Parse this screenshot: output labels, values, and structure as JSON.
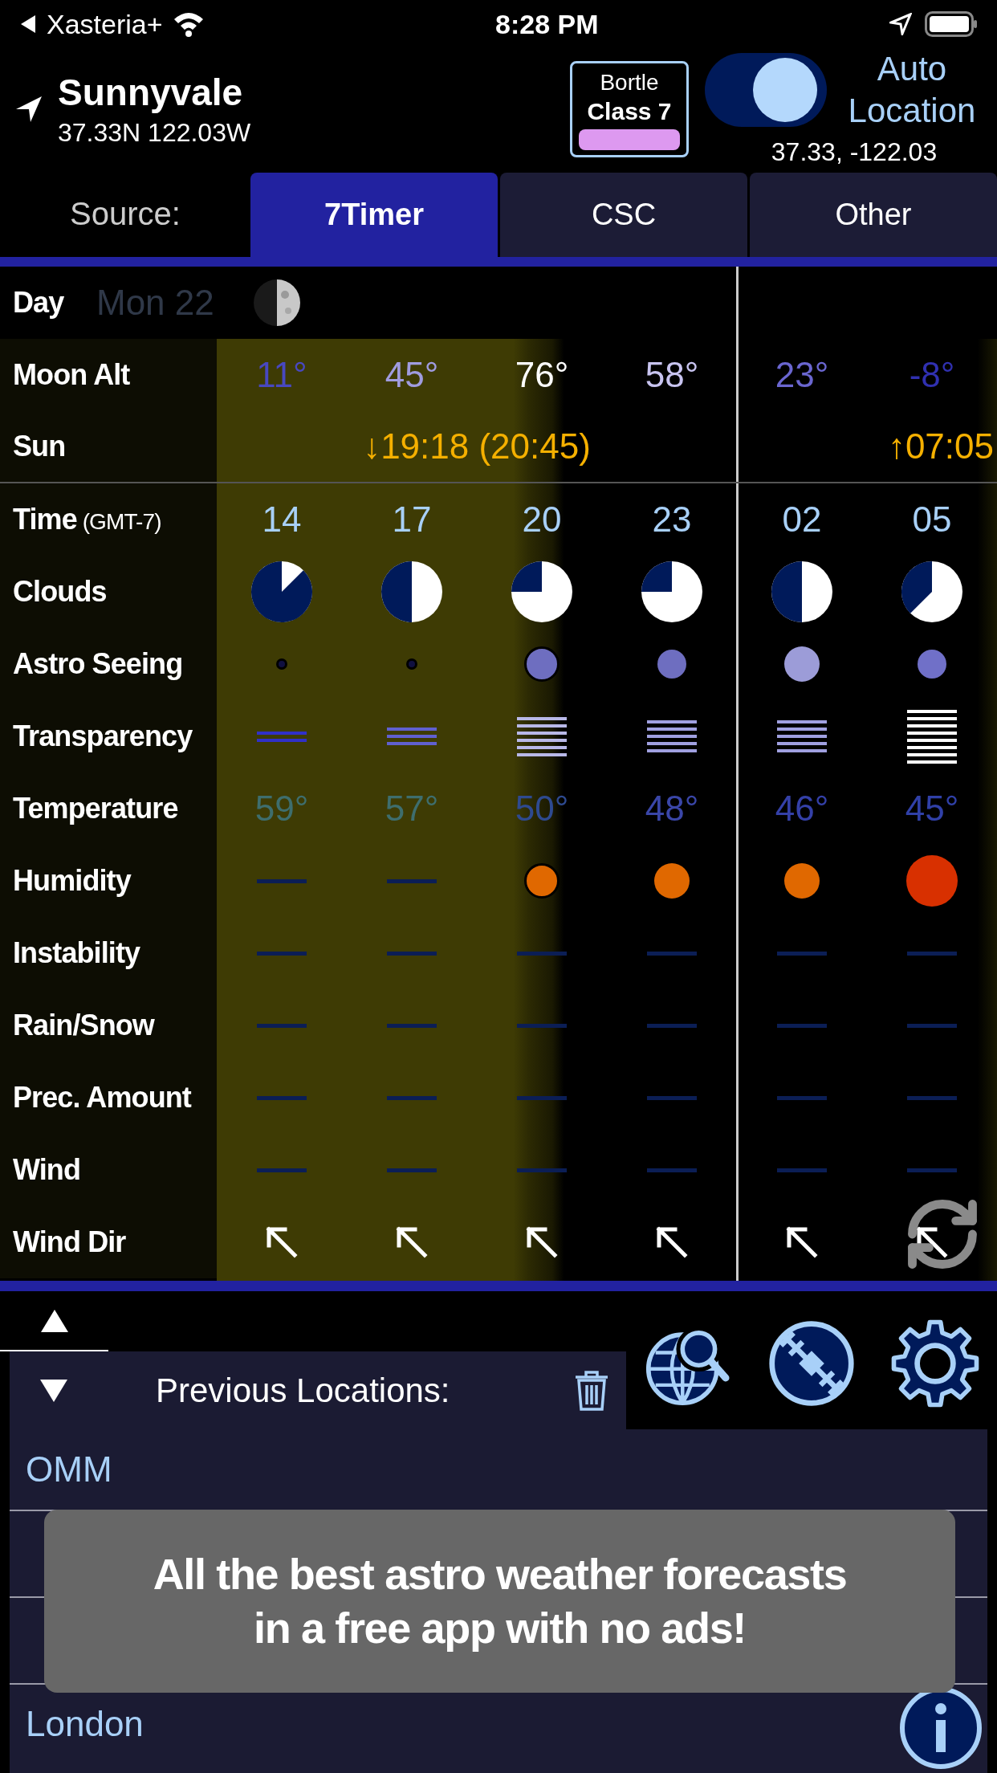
{
  "status_bar": {
    "back_label": "Xasteria+",
    "time": "8:28 PM"
  },
  "location": {
    "name": "Sunnyvale",
    "coords": "37.33N 122.03W"
  },
  "bortle": {
    "line1": "Bortle",
    "line2": "Class 7",
    "color": "#dd99f0"
  },
  "auto_location": {
    "on": true,
    "label": "Auto Location",
    "coords": "37.33, -122.03"
  },
  "source": {
    "label": "Source:",
    "tabs": [
      {
        "label": "7Timer",
        "selected": true
      },
      {
        "label": "CSC",
        "selected": false
      },
      {
        "label": "Other",
        "selected": false
      }
    ]
  },
  "forecast": {
    "day": {
      "label": "Day",
      "date": "Mon 22"
    },
    "rows": [
      {
        "kind": "cells",
        "label": "Moon Alt",
        "cells": [
          {
            "kind": "text",
            "text": "11°",
            "color": "#4848c0"
          },
          {
            "kind": "text",
            "text": "45°",
            "color": "#a09ce0"
          },
          {
            "kind": "text",
            "text": "76°",
            "color": "#ffffff"
          },
          {
            "kind": "text",
            "text": "58°",
            "color": "#c8c4f0"
          },
          {
            "kind": "text",
            "text": "23°",
            "color": "#6a66d0"
          },
          {
            "kind": "text",
            "text": "-8°",
            "color": "#3030b0"
          }
        ]
      },
      {
        "kind": "span",
        "label": "Sun",
        "sunset": "↓19:18 (20:45)",
        "sunrise": "↑07:05"
      },
      {
        "kind": "cells",
        "label": "Time",
        "sublabel": "(GMT-7)",
        "cells": [
          {
            "kind": "text",
            "text": "14",
            "color": "#a8d0f8"
          },
          {
            "kind": "text",
            "text": "17",
            "color": "#a8d0f8"
          },
          {
            "kind": "text",
            "text": "20",
            "color": "#a8d0f8"
          },
          {
            "kind": "text",
            "text": "23",
            "color": "#a8d0f8"
          },
          {
            "kind": "text",
            "text": "02",
            "color": "#a8d0f8"
          },
          {
            "kind": "text",
            "text": "05",
            "color": "#a8d0f8"
          }
        ]
      },
      {
        "kind": "cells",
        "label": "Clouds",
        "cells": [
          {
            "kind": "mostlycloudy"
          },
          {
            "kind": "halfcloudy"
          },
          {
            "kind": "quartercloudy"
          },
          {
            "kind": "quartercloudy"
          },
          {
            "kind": "halfcloudy"
          },
          {
            "kind": "partlycloudy"
          }
        ]
      },
      {
        "kind": "cells",
        "label": "Astro Seeing",
        "cells": [
          {
            "kind": "tinydot",
            "color": "#101040",
            "outlined": true
          },
          {
            "kind": "tinydot",
            "color": "#101040",
            "outlined": true
          },
          {
            "kind": "mediumdot",
            "color": "#6e6ec0",
            "outlined": true
          },
          {
            "kind": "smalldot",
            "color": "#6e6ec0",
            "outlined": false
          },
          {
            "kind": "mediumdot",
            "color": "#9c9cd8",
            "outlined": false
          },
          {
            "kind": "smalldot",
            "color": "#7070c8",
            "outlined": false
          }
        ]
      },
      {
        "kind": "cells",
        "label": "Transparency",
        "cells": [
          {
            "kind": "twolines",
            "color": "#3030c8"
          },
          {
            "kind": "threelines",
            "color": "#6060d0"
          },
          {
            "kind": "sixlines",
            "color": "#b8b8e8"
          },
          {
            "kind": "fivelines",
            "color": "#a0a0e0"
          },
          {
            "kind": "fivelines",
            "color": "#a0a0e0"
          },
          {
            "kind": "eightlines",
            "color": "#ffffff"
          }
        ]
      },
      {
        "kind": "cells",
        "label": "Temperature",
        "cells": [
          {
            "kind": "text",
            "text": "59°",
            "color": "#3e6e6e"
          },
          {
            "kind": "text",
            "text": "57°",
            "color": "#3e6e6e"
          },
          {
            "kind": "text",
            "text": "50°",
            "color": "#2e4a90"
          },
          {
            "kind": "text",
            "text": "48°",
            "color": "#3a46a8"
          },
          {
            "kind": "text",
            "text": "46°",
            "color": "#3440a8"
          },
          {
            "kind": "text",
            "text": "45°",
            "color": "#3040a8"
          }
        ]
      },
      {
        "kind": "cells",
        "label": "Humidity",
        "cells": [
          {
            "kind": "dash"
          },
          {
            "kind": "dash"
          },
          {
            "kind": "mediumdot",
            "color": "#e06800",
            "outlined": true
          },
          {
            "kind": "mediumdot",
            "color": "#e06800",
            "outlined": false
          },
          {
            "kind": "mediumdot",
            "color": "#e06800",
            "outlined": false
          },
          {
            "kind": "largedot",
            "color": "#d83000",
            "outlined": false
          }
        ]
      },
      {
        "kind": "cells",
        "label": "Instability",
        "cells": [
          {
            "kind": "dash"
          },
          {
            "kind": "dash"
          },
          {
            "kind": "dash"
          },
          {
            "kind": "dash"
          },
          {
            "kind": "dash"
          },
          {
            "kind": "dash"
          }
        ]
      },
      {
        "kind": "cells",
        "label": "Rain/Snow",
        "cells": [
          {
            "kind": "dash"
          },
          {
            "kind": "dash"
          },
          {
            "kind": "dash"
          },
          {
            "kind": "dash"
          },
          {
            "kind": "dash"
          },
          {
            "kind": "dash"
          }
        ]
      },
      {
        "kind": "cells",
        "label": "Prec. Amount",
        "cells": [
          {
            "kind": "dash"
          },
          {
            "kind": "dash"
          },
          {
            "kind": "dash"
          },
          {
            "kind": "dash"
          },
          {
            "kind": "dash"
          },
          {
            "kind": "dash"
          }
        ]
      },
      {
        "kind": "cells",
        "label": "Wind",
        "cells": [
          {
            "kind": "dash"
          },
          {
            "kind": "dash"
          },
          {
            "kind": "dash"
          },
          {
            "kind": "dash"
          },
          {
            "kind": "dash"
          },
          {
            "kind": "dash"
          }
        ]
      },
      {
        "kind": "cells",
        "label": "Wind Dir",
        "cells": [
          {
            "kind": "arrow"
          },
          {
            "kind": "arrow"
          },
          {
            "kind": "arrow"
          },
          {
            "kind": "arrow"
          },
          {
            "kind": "arrow"
          },
          {
            "kind": "arrow"
          }
        ]
      }
    ]
  },
  "locations_panel": {
    "title": "Previous Locations:",
    "items": [
      "OMM",
      "London"
    ]
  },
  "promo": {
    "lines": [
      "All the best astro weather forecasts",
      "in a free app with no ads!"
    ]
  }
}
